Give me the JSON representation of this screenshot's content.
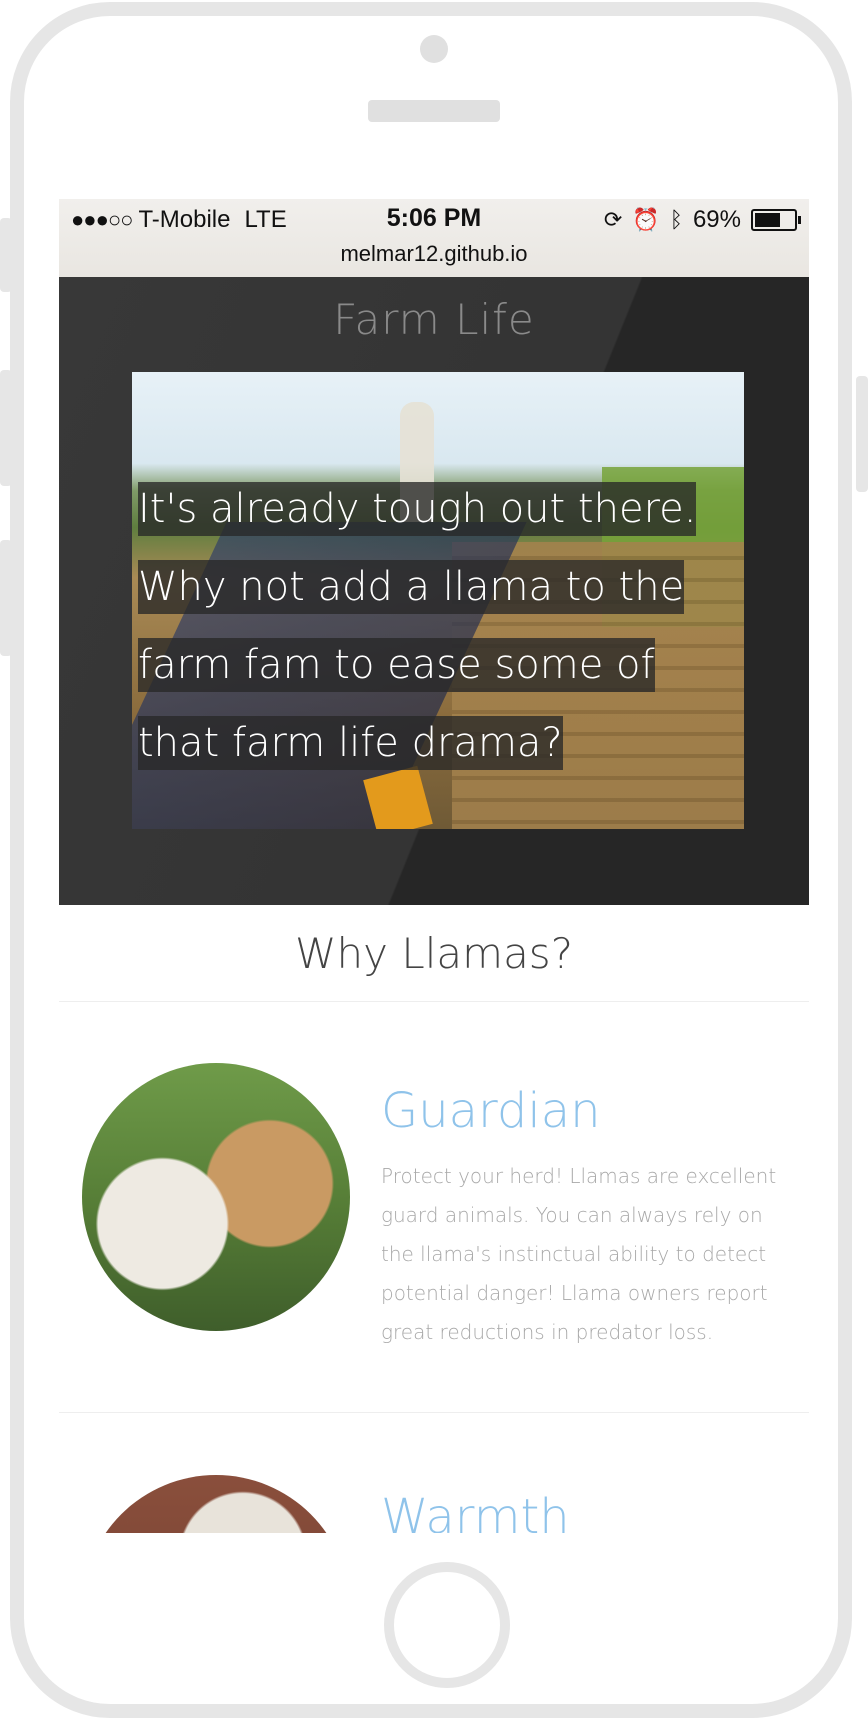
{
  "status": {
    "signal": "●●●○○",
    "carrier": "T-Mobile",
    "network": "LTE",
    "time": "5:06 PM",
    "battery_percent": "69%",
    "battery_level": 0.69,
    "icons": [
      "rotation-lock-icon",
      "alarm-icon",
      "bluetooth-icon"
    ],
    "url": "melmar12.github.io"
  },
  "hero": {
    "title": "Farm Life",
    "caption": "It's already tough out there. Why not add a llama to the farm fam to ease some of that farm life drama?"
  },
  "section": {
    "title": "Why Llamas?"
  },
  "features": [
    {
      "heading": "Guardian",
      "text": "Protect your herd! Llamas are excellent guard animals. You can always rely on the llama's instinctual ability to detect potential danger! Llama owners report great reductions in predator loss."
    },
    {
      "heading": "Warmth"
    }
  ],
  "colors": {
    "accent": "#8fc3ea",
    "hero_bg": "#262626",
    "device_frame": "#e6e6e6"
  }
}
